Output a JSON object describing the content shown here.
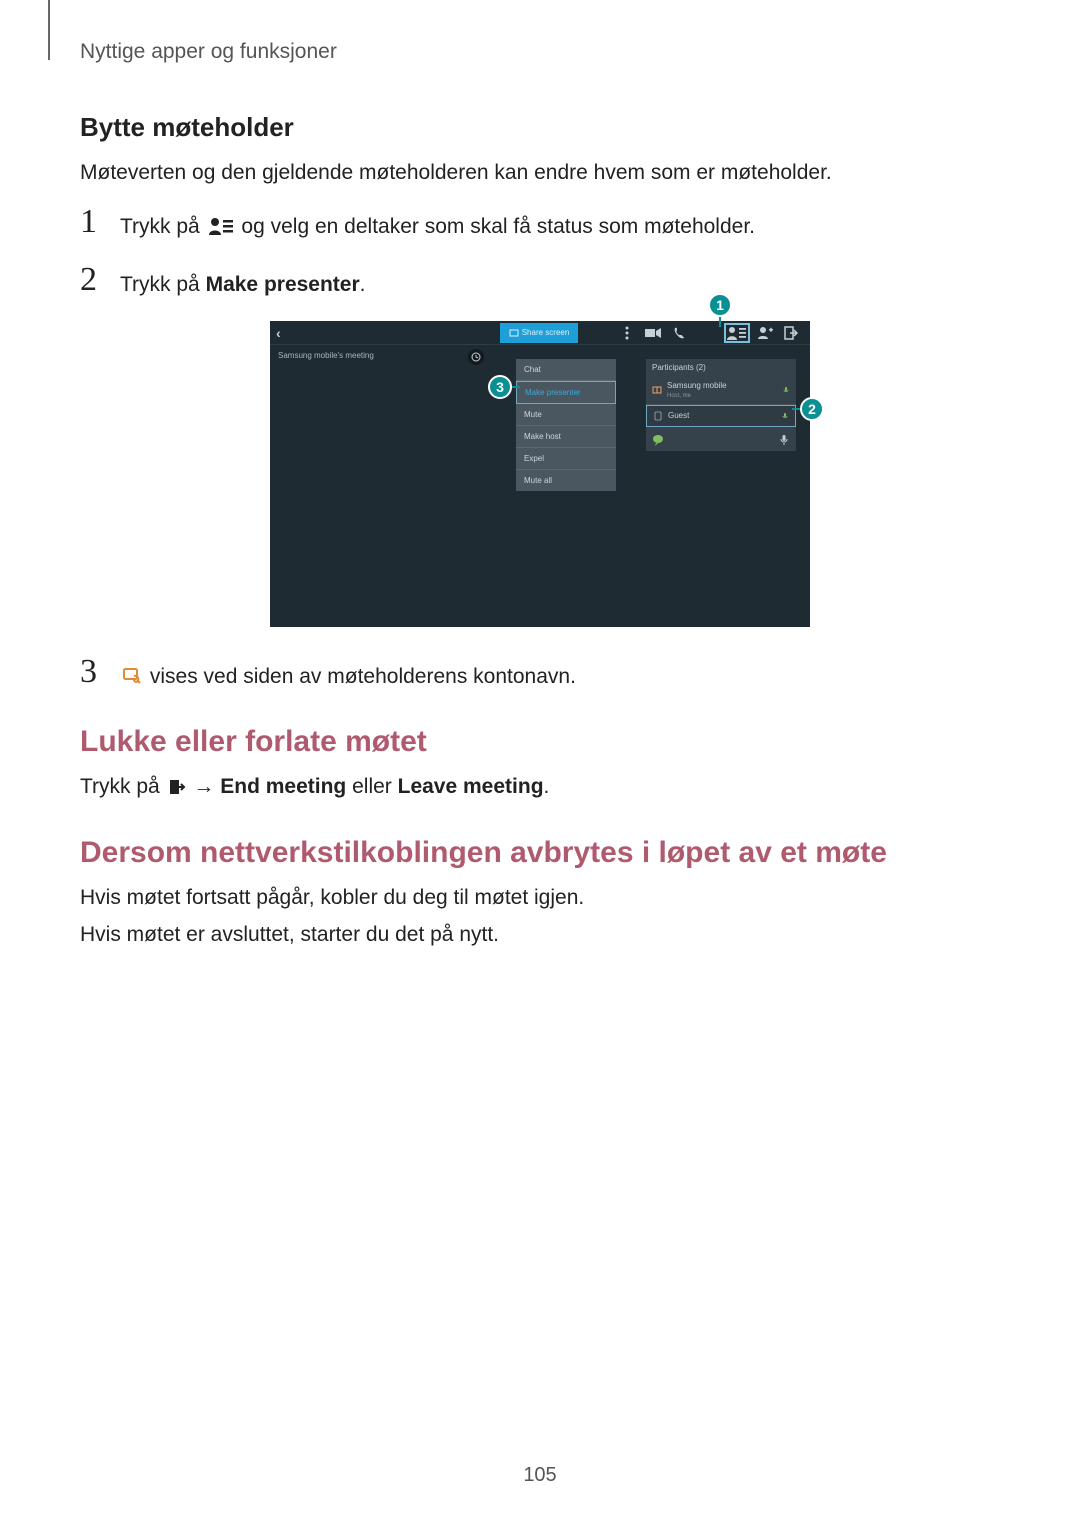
{
  "breadcrumb": "Nyttige apper og funksjoner",
  "h3_change": "Bytte møteholder",
  "intro_change": "Møteverten og den gjeldende møteholderen kan endre hvem som er møteholder.",
  "step1": {
    "num": "1",
    "pre": "Trykk på ",
    "post": " og velg en deltaker som skal få status som møteholder."
  },
  "step2": {
    "num": "2",
    "pre": "Trykk på ",
    "bold": "Make presenter",
    "post": "."
  },
  "step3": {
    "num": "3",
    "post": " vises ved siden av møteholderens kontonavn."
  },
  "callouts": {
    "c1": "1",
    "c2": "2",
    "c3": "3"
  },
  "mock": {
    "share": "Share screen",
    "title": "Samsung mobile's meeting",
    "dd": [
      "Chat",
      "Make presenter",
      "Mute",
      "Make host",
      "Expel",
      "Mute all"
    ],
    "panel_hdr": "Participants (2)",
    "part1": "Samsung mobile",
    "part1_sub": "Host, me",
    "part2": "Guest"
  },
  "h2_close": "Lukke eller forlate møtet",
  "close": {
    "pre": "Trykk på ",
    "arrow": " → ",
    "b1": "End meeting",
    "mid": " eller ",
    "b2": "Leave meeting",
    "post": "."
  },
  "h2_net": "Dersom nettverkstilkoblingen avbrytes i løpet av et møte",
  "net1": "Hvis møtet fortsatt pågår, kobler du deg til møtet igjen.",
  "net2": "Hvis møtet er avsluttet, starter du det på nytt.",
  "pagenum": "105"
}
